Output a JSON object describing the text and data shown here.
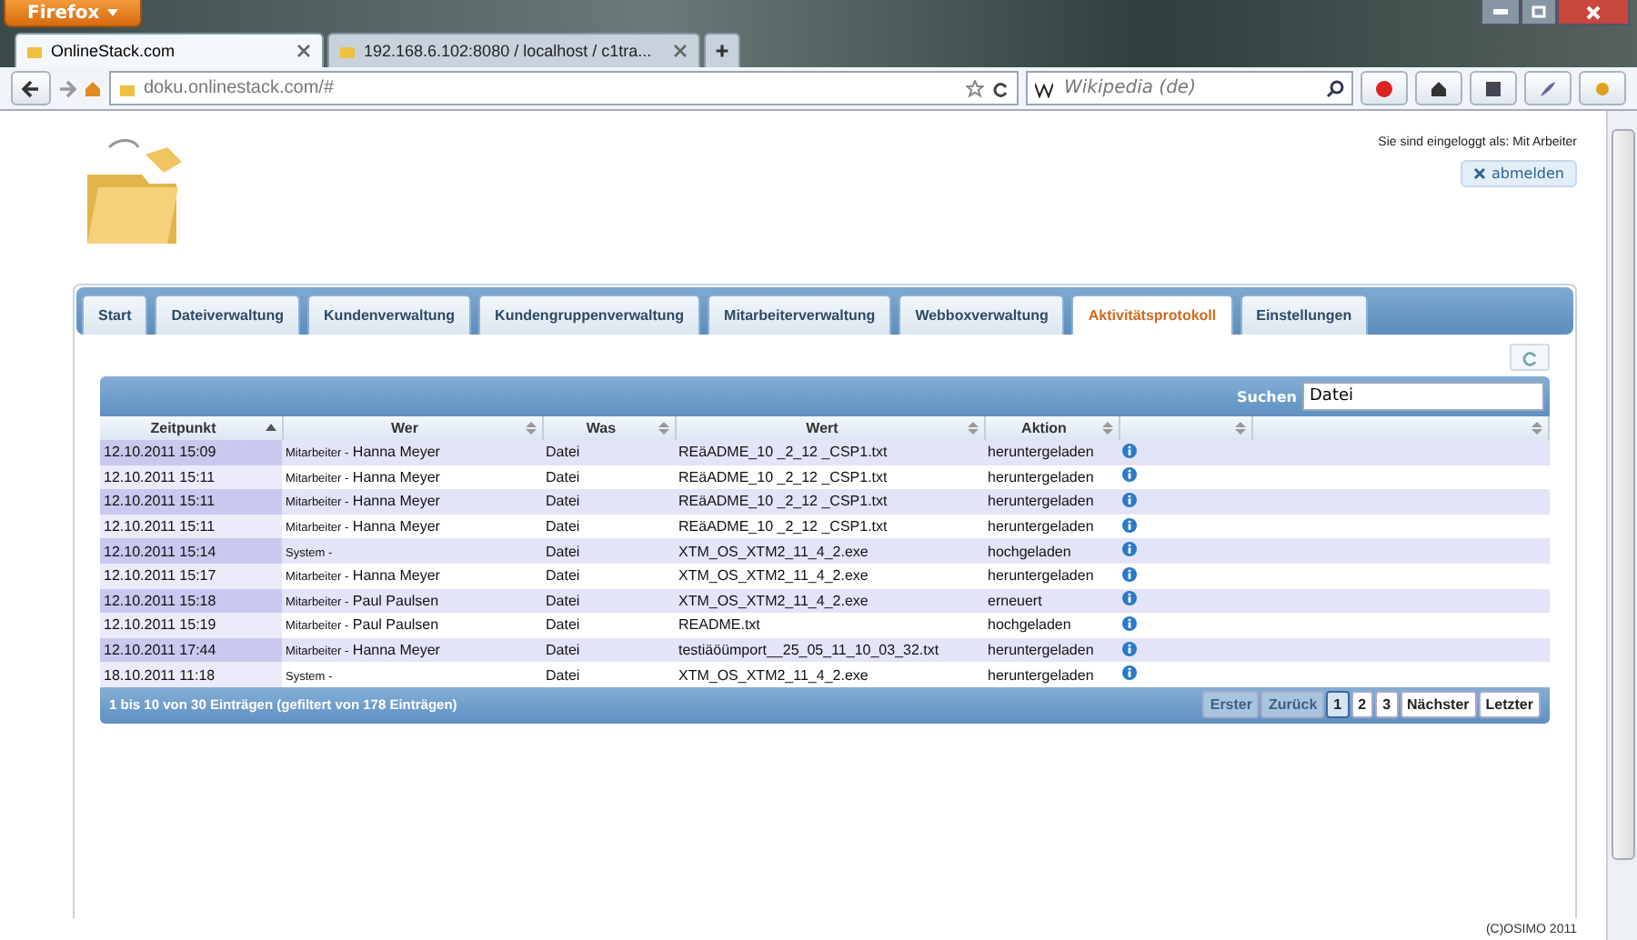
{
  "browser": {
    "menu_button": "Firefox",
    "tabs": [
      {
        "label": "OnlineStack.com",
        "selected": true
      },
      {
        "label": "192.168.6.102:8080 / localhost / c1tra...",
        "selected": false
      }
    ],
    "address": "doku.onlinestack.com/#",
    "search_placeholder": "Wikipedia (de)"
  },
  "header": {
    "login_text": "Sie sind eingeloggt als: Mit Arbeiter",
    "logout": "abmelden"
  },
  "nav_tabs": [
    {
      "label": "Start",
      "selected": false
    },
    {
      "label": "Dateiverwaltung",
      "selected": false
    },
    {
      "label": "Kundenverwaltung",
      "selected": false
    },
    {
      "label": "Kundengruppenverwaltung",
      "selected": false
    },
    {
      "label": "Mitarbeiterverwaltung",
      "selected": false
    },
    {
      "label": "Webboxverwaltung",
      "selected": false
    },
    {
      "label": "Aktivitätsprotokoll",
      "selected": true
    },
    {
      "label": "Einstellungen",
      "selected": false
    }
  ],
  "search": {
    "label": "Suchen",
    "value": "Datei"
  },
  "table": {
    "columns": [
      {
        "label": "Zeitpunkt",
        "sorted": true
      },
      {
        "label": "Wer",
        "sorted": false
      },
      {
        "label": "Was",
        "sorted": false
      },
      {
        "label": "Wert",
        "sorted": false
      },
      {
        "label": "Aktion",
        "sorted": false
      },
      {
        "sorted": false
      },
      {
        "sorted": false
      }
    ],
    "rows": [
      {
        "zeitpunkt": "12.10.2011 15:09",
        "wer_role": "Mitarbeiter -",
        "wer_name": "Hanna Meyer",
        "was": "Datei",
        "wert": "REäADME_10 _2_12 _CSP1.txt",
        "aktion": "heruntergeladen"
      },
      {
        "zeitpunkt": "12.10.2011 15:11",
        "wer_role": "Mitarbeiter -",
        "wer_name": "Hanna Meyer",
        "was": "Datei",
        "wert": "REäADME_10 _2_12 _CSP1.txt",
        "aktion": "heruntergeladen"
      },
      {
        "zeitpunkt": "12.10.2011 15:11",
        "wer_role": "Mitarbeiter -",
        "wer_name": "Hanna Meyer",
        "was": "Datei",
        "wert": "REäADME_10 _2_12 _CSP1.txt",
        "aktion": "heruntergeladen"
      },
      {
        "zeitpunkt": "12.10.2011 15:11",
        "wer_role": "Mitarbeiter -",
        "wer_name": "Hanna Meyer",
        "was": "Datei",
        "wert": "REäADME_10 _2_12 _CSP1.txt",
        "aktion": "heruntergeladen"
      },
      {
        "zeitpunkt": "12.10.2011 15:14",
        "wer_role": "System -",
        "was": "Datei",
        "wert": "XTM_OS_XTM2_11_4_2.exe",
        "aktion": "hochgeladen"
      },
      {
        "zeitpunkt": "12.10.2011 15:17",
        "wer_role": "Mitarbeiter -",
        "wer_name": "Hanna Meyer",
        "was": "Datei",
        "wert": "XTM_OS_XTM2_11_4_2.exe",
        "aktion": "heruntergeladen"
      },
      {
        "zeitpunkt": "12.10.2011 15:18",
        "wer_role": "Mitarbeiter -",
        "wer_name": "Paul Paulsen",
        "was": "Datei",
        "wert": "XTM_OS_XTM2_11_4_2.exe",
        "aktion": "erneuert"
      },
      {
        "zeitpunkt": "12.10.2011 15:19",
        "wer_role": "Mitarbeiter -",
        "wer_name": "Paul Paulsen",
        "was": "Datei",
        "wert": "README.txt",
        "aktion": "hochgeladen"
      },
      {
        "zeitpunkt": "12.10.2011 17:44",
        "wer_role": "Mitarbeiter -",
        "wer_name": "Hanna Meyer",
        "was": "Datei",
        "wert": "testiäöümport__25_05_11_10_03_32.txt",
        "aktion": "heruntergeladen"
      },
      {
        "zeitpunkt": "18.10.2011 11:18",
        "wer_role": "System -",
        "was": "Datei",
        "wert": "XTM_OS_XTM2_11_4_2.exe",
        "aktion": "heruntergeladen"
      }
    ]
  },
  "footer": {
    "info": "1 bis 10 von 30 Einträgen (gefiltert von 178 Einträgen)",
    "pages": [
      {
        "label": "Erster",
        "disabled": true,
        "selected": false
      },
      {
        "label": "Zurück",
        "disabled": true,
        "selected": false
      },
      {
        "label": "1",
        "disabled": false,
        "selected": true
      },
      {
        "label": "2",
        "disabled": false,
        "selected": false
      },
      {
        "label": "3",
        "disabled": false,
        "selected": false
      },
      {
        "label": "Nächster",
        "disabled": false,
        "selected": false
      },
      {
        "label": "Letzter",
        "disabled": false,
        "selected": false
      }
    ]
  },
  "copyright": "(C)OSIMO 2011"
}
